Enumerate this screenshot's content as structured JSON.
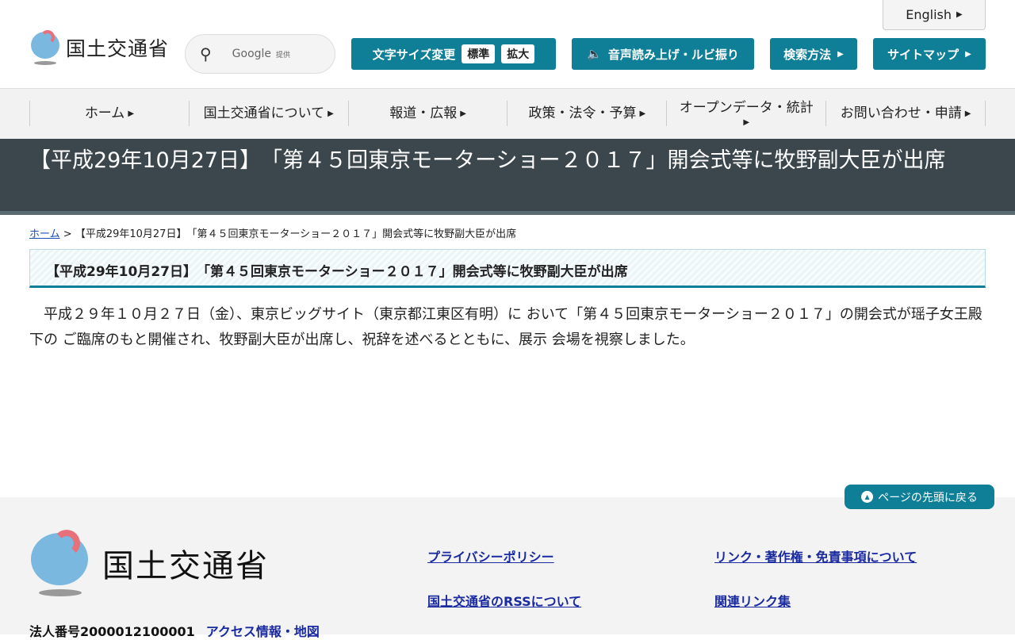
{
  "header": {
    "logo_text": "国土交通省",
    "search": {
      "placeholder": "Google",
      "provided": "提供"
    },
    "font_size": {
      "label": "文字サイズ変更",
      "standard": "標準",
      "large": "拡大"
    },
    "speech": "音声読み上げ・ルビ振り",
    "search_method": "検索方法",
    "sitemap": "サイトマップ",
    "english": "English"
  },
  "nav": [
    "ホーム",
    "国土交通省について",
    "報道・広報",
    "政策・法令・予算",
    "オープンデータ・統計",
    "お問い合わせ・申請"
  ],
  "page_title": "【平成29年10月27日】　「第４５回東京モーターショー２０１７」開会式等に牧野副大臣が出席",
  "breadcrumb": {
    "home": "ホーム",
    "sep": ">",
    "current": "【平成29年10月27日】　「第４５回東京モーターショー２０１７」開会式等に牧野副大臣が出席"
  },
  "heading": "【平成29年10月27日】　「第４５回東京モーターショー２０１７」開会式等に牧野副大臣が出席",
  "body": "平成２９年１０月２７日（金）、東京ビッグサイト（東京都江東区有明）に おいて「第４５回東京モーターショー２０１７」の開会式が瑶子女王殿下の ご臨席のもと開催され、牧野副大臣が出席し、祝辞を述べるとともに、展示 会場を視察しました。",
  "back_to_top": "ページの先頭に戻る",
  "footer": {
    "logo_text": "国土交通省",
    "links": [
      "プライバシーポリシー",
      "リンク・著作権・免責事項について",
      "国土交通省のRSSについて",
      "関連リンク集"
    ],
    "corp_number": "法人番号2000012100001",
    "access": "アクセス情報・地図"
  }
}
